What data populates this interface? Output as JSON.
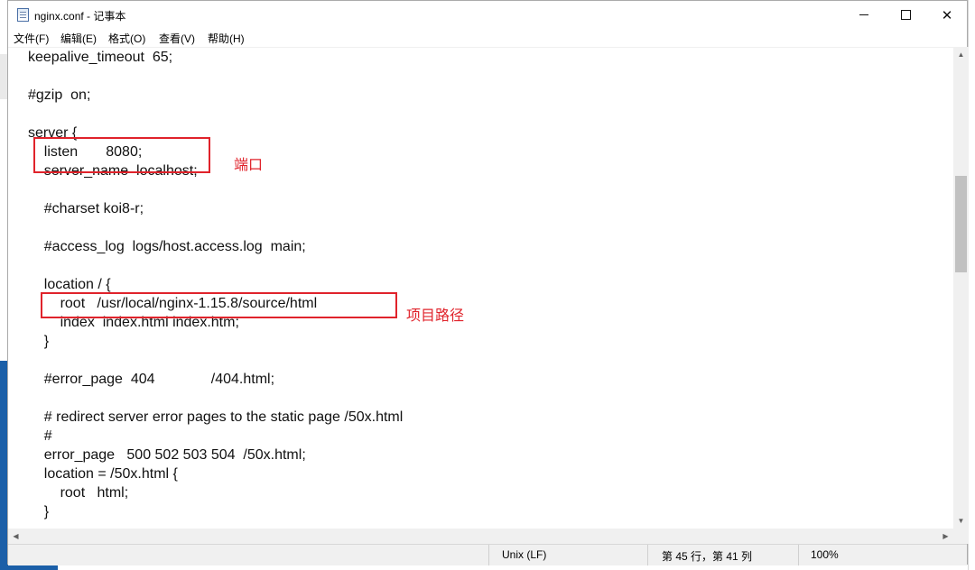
{
  "window": {
    "title": "nginx.conf - 记事本",
    "minimize_icon": "minimize-icon",
    "maximize_icon": "maximize-icon",
    "close_icon": "close-icon"
  },
  "menu": {
    "file": "文件(F)",
    "edit": "编辑(E)",
    "format": "格式(O)",
    "view": "查看(V)",
    "help": "帮助(H)"
  },
  "code_lines": [
    "keepalive_timeout  65;",
    "",
    "#gzip  on;",
    "",
    "server {",
    "    listen       8080;",
    "    server_name  localhost;",
    "",
    "    #charset koi8-r;",
    "",
    "    #access_log  logs/host.access.log  main;",
    "",
    "    location / {",
    "        root   /usr/local/nginx-1.15.8/source/html",
    "        index  index.html index.htm;",
    "    }",
    "",
    "    #error_page  404              /404.html;",
    "",
    "    # redirect server error pages to the static page /50x.html",
    "    #",
    "    error_page   500 502 503 504  /50x.html;",
    "    location = /50x.html {",
    "        root   html;",
    "    }"
  ],
  "annotations": {
    "port_label": "端口",
    "path_label": "项目路径",
    "color": "#e0232b"
  },
  "status": {
    "line_ending": "Unix (LF)",
    "position": "第 45 行，第 41 列",
    "zoom": "100%"
  }
}
